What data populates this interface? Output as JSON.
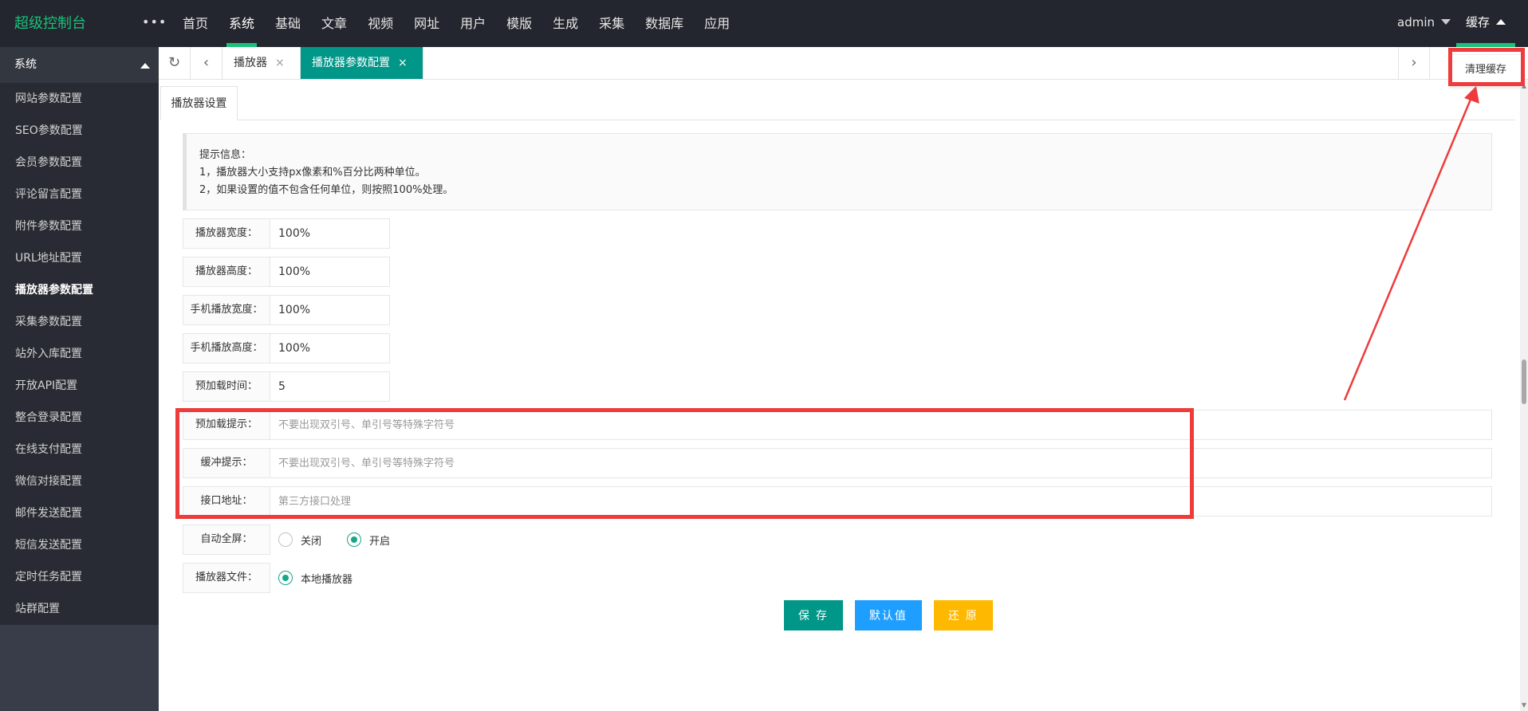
{
  "header": {
    "logo": "超级控制台",
    "more": "•••",
    "nav": [
      "首页",
      "系统",
      "基础",
      "文章",
      "视频",
      "网址",
      "用户",
      "模版",
      "生成",
      "采集",
      "数据库",
      "应用"
    ],
    "active_nav": "系统",
    "user": "admin",
    "cache": "缓存",
    "cache_menu_item": "清理缓存"
  },
  "sidebar": {
    "group": "系统",
    "items": [
      "网站参数配置",
      "SEO参数配置",
      "会员参数配置",
      "评论留言配置",
      "附件参数配置",
      "URL地址配置",
      "播放器参数配置",
      "采集参数配置",
      "站外入库配置",
      "开放API配置",
      "整合登录配置",
      "在线支付配置",
      "微信对接配置",
      "邮件发送配置",
      "短信发送配置",
      "定时任务配置",
      "站群配置"
    ],
    "active": "播放器参数配置"
  },
  "tabs": {
    "refresh_icon": "refresh-icon",
    "items": [
      {
        "label": "播放器",
        "close": "×"
      },
      {
        "label": "播放器参数配置",
        "close": "×"
      }
    ]
  },
  "page": {
    "subtab": "播放器设置",
    "notice": {
      "title": "提示信息：",
      "lines": [
        "1，播放器大小支持px像素和%百分比两种单位。",
        "2，如果设置的值不包含任何单位，则按照100%处理。"
      ]
    },
    "fields": {
      "width": {
        "label": "播放器宽度：",
        "value": "100%"
      },
      "height": {
        "label": "播放器高度：",
        "value": "100%"
      },
      "mobile_width": {
        "label": "手机播放宽度：",
        "value": "100%"
      },
      "mobile_height": {
        "label": "手机播放高度：",
        "value": "100%"
      },
      "preload_time": {
        "label": "预加载时间：",
        "value": "5"
      },
      "preload_tip": {
        "label": "预加载提示：",
        "placeholder": "不要出现双引号、单引号等特殊字符号"
      },
      "buffer_tip": {
        "label": "缓冲提示：",
        "placeholder": "不要出现双引号、单引号等特殊字符号"
      },
      "api_url": {
        "label": "接口地址：",
        "placeholder": "第三方接口处理"
      },
      "autofull": {
        "label": "自动全屏：",
        "options": [
          "关闭",
          "开启"
        ],
        "selected": "开启"
      },
      "player_file": {
        "label": "播放器文件：",
        "options": [
          "本地播放器"
        ],
        "selected": "本地播放器"
      }
    },
    "buttons": {
      "save": "保 存",
      "default": "默认值",
      "restore": "还 原"
    }
  },
  "colors": {
    "accent": "#009688",
    "green": "#19c17a",
    "blue": "#1e9fff",
    "orange": "#ffb800",
    "annotation": "#ee3b3b",
    "header_bg": "#23262e",
    "sidebar_bg": "#282b33"
  }
}
